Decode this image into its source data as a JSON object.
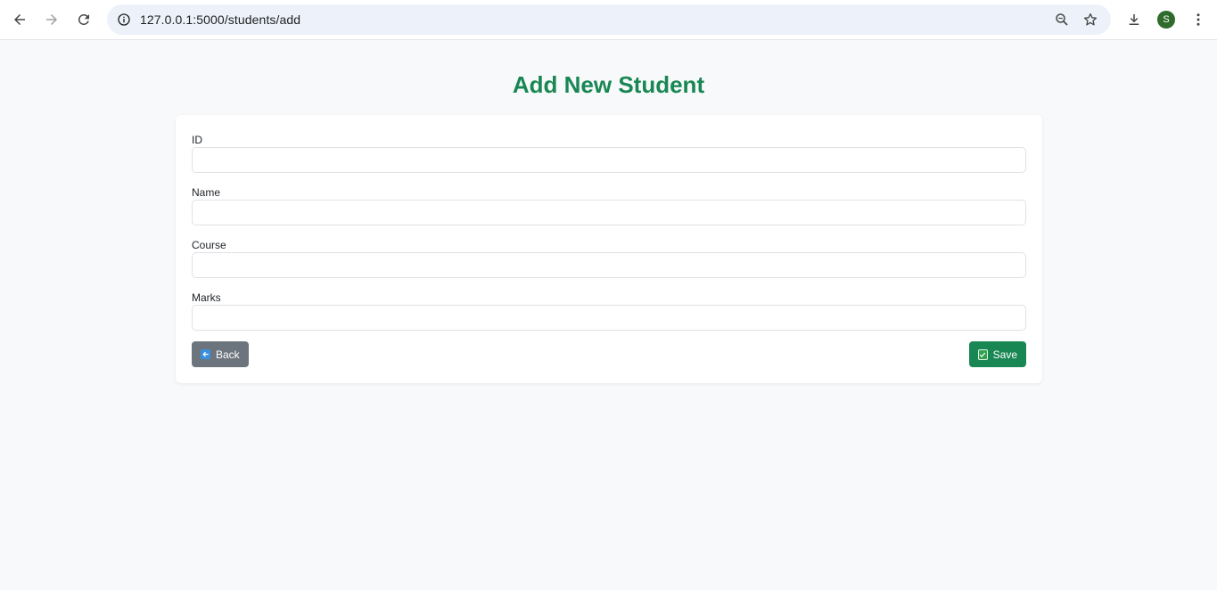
{
  "browser": {
    "url": "127.0.0.1:5000/students/add",
    "profile_initial": "S"
  },
  "page": {
    "title": "Add New Student"
  },
  "form": {
    "fields": [
      {
        "label": "ID",
        "value": "",
        "placeholder": ""
      },
      {
        "label": "Name",
        "value": "",
        "placeholder": ""
      },
      {
        "label": "Course",
        "value": "",
        "placeholder": ""
      },
      {
        "label": "Marks",
        "value": "",
        "placeholder": ""
      }
    ],
    "back_label": "Back",
    "save_label": "Save"
  },
  "colors": {
    "accent": "#198754",
    "back_button": "#6c757d",
    "background": "#f8f9fa"
  },
  "icons": [
    "back-arrow-icon",
    "forward-arrow-icon",
    "reload-icon",
    "site-info-icon",
    "zoom-icon",
    "bookmark-star-icon",
    "download-icon",
    "menu-kebab-icon",
    "back-emoji-icon",
    "check-emoji-icon"
  ]
}
